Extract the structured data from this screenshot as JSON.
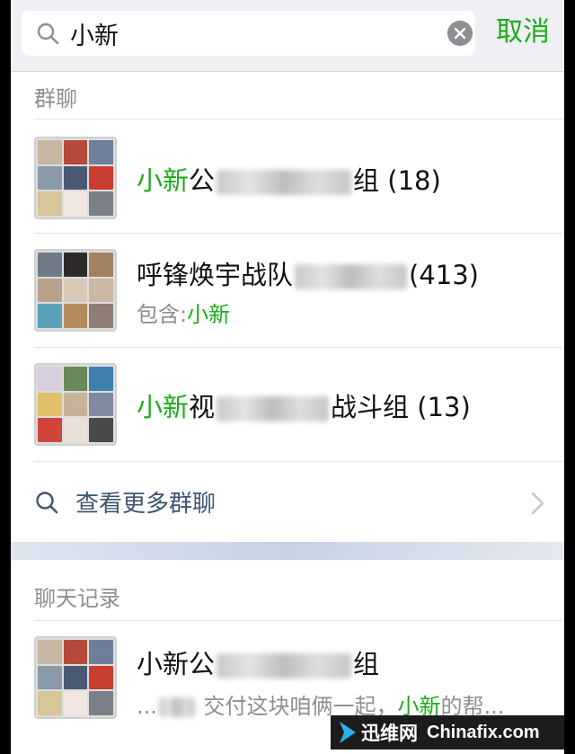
{
  "search": {
    "query": "小新",
    "cancel_label": "取消"
  },
  "group_section": {
    "title": "群聊",
    "items": [
      {
        "highlight": "小新",
        "name_tail": "公",
        "suffix": "组 (18)"
      },
      {
        "name_prefix": "呼锋焕宇战队",
        "suffix": "(413)",
        "sub_label": "包含:",
        "sub_highlight": "小新"
      },
      {
        "highlight": "小新",
        "name_tail": "视",
        "suffix": "战斗组 (13)"
      }
    ],
    "more_label": "查看更多群聊"
  },
  "chat_section": {
    "title": "聊天记录",
    "items": [
      {
        "name_prefix": "小新公",
        "suffix": "组",
        "msg_prefix": "...",
        "msg_mid": "交付这块咱俩一起，",
        "msg_highlight": "小新",
        "msg_tail": "的帮..."
      }
    ]
  },
  "watermark": {
    "cn": "迅维网",
    "en": "Chinafix.com"
  },
  "colors": {
    "highlight": "#1aad19",
    "link": "#3e5572",
    "secondary_text": "#8e8e93"
  },
  "icons": [
    "search-icon",
    "clear-icon",
    "chevron-right-icon"
  ]
}
